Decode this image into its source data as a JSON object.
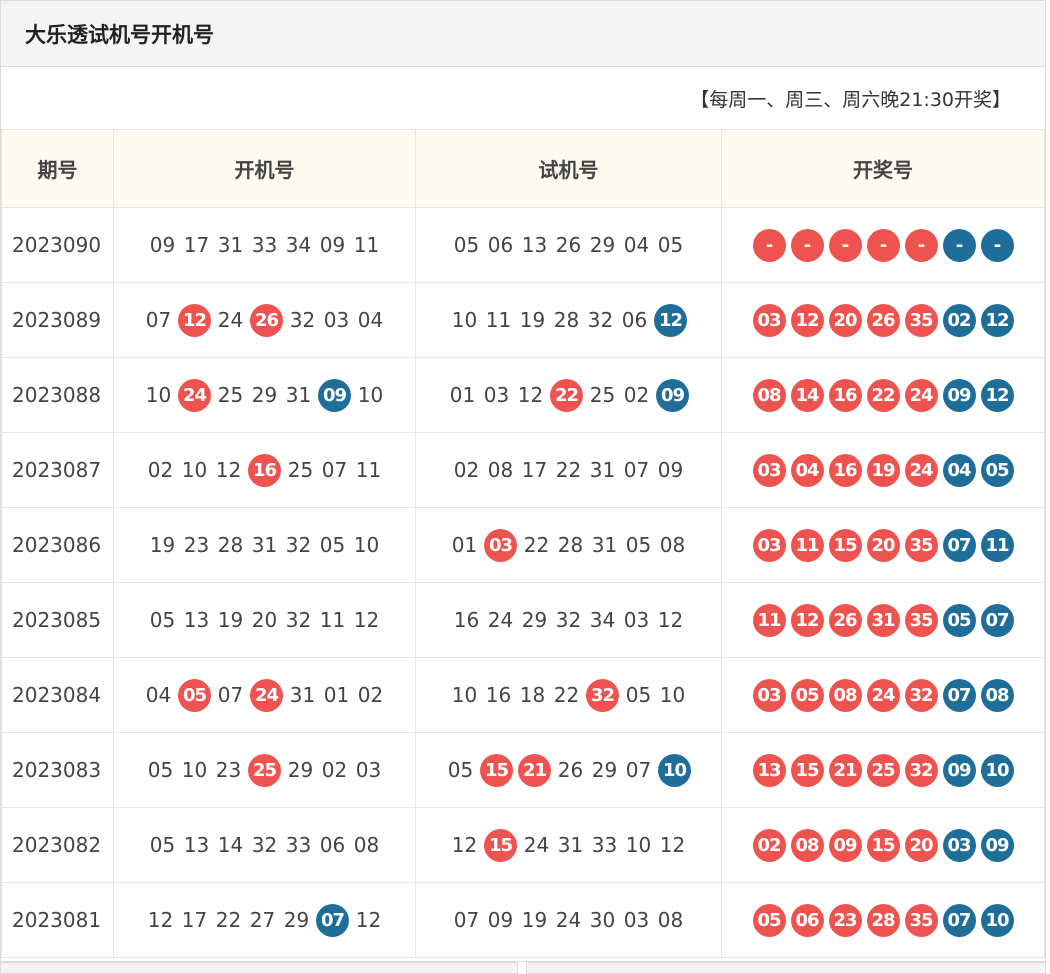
{
  "title": "大乐透试机号开机号",
  "note": "【每周一、周三、周六晚21:30开奖】",
  "headers": {
    "period": "期号",
    "open": "开机号",
    "trial": "试机号",
    "draw": "开奖号"
  },
  "colors": {
    "red_ball": "#ef5350",
    "blue_ball": "#1f6e9a",
    "header_bg": "#fdfaf1"
  },
  "rows": [
    {
      "period": "2023090",
      "open": [
        [
          "09",
          ""
        ],
        [
          "17",
          ""
        ],
        [
          "31",
          ""
        ],
        [
          "33",
          ""
        ],
        [
          "34",
          ""
        ],
        [
          "09",
          ""
        ],
        [
          "11",
          ""
        ]
      ],
      "trial": [
        [
          "05",
          ""
        ],
        [
          "06",
          ""
        ],
        [
          "13",
          ""
        ],
        [
          "26",
          ""
        ],
        [
          "29",
          ""
        ],
        [
          "04",
          ""
        ],
        [
          "05",
          ""
        ]
      ],
      "draw": [
        [
          "-",
          "red"
        ],
        [
          "-",
          "red"
        ],
        [
          "-",
          "red"
        ],
        [
          "-",
          "red"
        ],
        [
          "-",
          "red"
        ],
        [
          "-",
          "blue"
        ],
        [
          "-",
          "blue"
        ]
      ]
    },
    {
      "period": "2023089",
      "open": [
        [
          "07",
          ""
        ],
        [
          "12",
          "red"
        ],
        [
          "24",
          ""
        ],
        [
          "26",
          "red"
        ],
        [
          "32",
          ""
        ],
        [
          "03",
          ""
        ],
        [
          "04",
          ""
        ]
      ],
      "trial": [
        [
          "10",
          ""
        ],
        [
          "11",
          ""
        ],
        [
          "19",
          ""
        ],
        [
          "28",
          ""
        ],
        [
          "32",
          ""
        ],
        [
          "06",
          ""
        ],
        [
          "12",
          "blue"
        ]
      ],
      "draw": [
        [
          "03",
          "red"
        ],
        [
          "12",
          "red"
        ],
        [
          "20",
          "red"
        ],
        [
          "26",
          "red"
        ],
        [
          "35",
          "red"
        ],
        [
          "02",
          "blue"
        ],
        [
          "12",
          "blue"
        ]
      ]
    },
    {
      "period": "2023088",
      "open": [
        [
          "10",
          ""
        ],
        [
          "24",
          "red"
        ],
        [
          "25",
          ""
        ],
        [
          "29",
          ""
        ],
        [
          "31",
          ""
        ],
        [
          "09",
          "blue"
        ],
        [
          "10",
          ""
        ]
      ],
      "trial": [
        [
          "01",
          ""
        ],
        [
          "03",
          ""
        ],
        [
          "12",
          ""
        ],
        [
          "22",
          "red"
        ],
        [
          "25",
          ""
        ],
        [
          "02",
          ""
        ],
        [
          "09",
          "blue"
        ]
      ],
      "draw": [
        [
          "08",
          "red"
        ],
        [
          "14",
          "red"
        ],
        [
          "16",
          "red"
        ],
        [
          "22",
          "red"
        ],
        [
          "24",
          "red"
        ],
        [
          "09",
          "blue"
        ],
        [
          "12",
          "blue"
        ]
      ]
    },
    {
      "period": "2023087",
      "open": [
        [
          "02",
          ""
        ],
        [
          "10",
          ""
        ],
        [
          "12",
          ""
        ],
        [
          "16",
          "red"
        ],
        [
          "25",
          ""
        ],
        [
          "07",
          ""
        ],
        [
          "11",
          ""
        ]
      ],
      "trial": [
        [
          "02",
          ""
        ],
        [
          "08",
          ""
        ],
        [
          "17",
          ""
        ],
        [
          "22",
          ""
        ],
        [
          "31",
          ""
        ],
        [
          "07",
          ""
        ],
        [
          "09",
          ""
        ]
      ],
      "draw": [
        [
          "03",
          "red"
        ],
        [
          "04",
          "red"
        ],
        [
          "16",
          "red"
        ],
        [
          "19",
          "red"
        ],
        [
          "24",
          "red"
        ],
        [
          "04",
          "blue"
        ],
        [
          "05",
          "blue"
        ]
      ]
    },
    {
      "period": "2023086",
      "open": [
        [
          "19",
          ""
        ],
        [
          "23",
          ""
        ],
        [
          "28",
          ""
        ],
        [
          "31",
          ""
        ],
        [
          "32",
          ""
        ],
        [
          "05",
          ""
        ],
        [
          "10",
          ""
        ]
      ],
      "trial": [
        [
          "01",
          ""
        ],
        [
          "03",
          "red"
        ],
        [
          "22",
          ""
        ],
        [
          "28",
          ""
        ],
        [
          "31",
          ""
        ],
        [
          "05",
          ""
        ],
        [
          "08",
          ""
        ]
      ],
      "draw": [
        [
          "03",
          "red"
        ],
        [
          "11",
          "red"
        ],
        [
          "15",
          "red"
        ],
        [
          "20",
          "red"
        ],
        [
          "35",
          "red"
        ],
        [
          "07",
          "blue"
        ],
        [
          "11",
          "blue"
        ]
      ]
    },
    {
      "period": "2023085",
      "open": [
        [
          "05",
          ""
        ],
        [
          "13",
          ""
        ],
        [
          "19",
          ""
        ],
        [
          "20",
          ""
        ],
        [
          "32",
          ""
        ],
        [
          "11",
          ""
        ],
        [
          "12",
          ""
        ]
      ],
      "trial": [
        [
          "16",
          ""
        ],
        [
          "24",
          ""
        ],
        [
          "29",
          ""
        ],
        [
          "32",
          ""
        ],
        [
          "34",
          ""
        ],
        [
          "03",
          ""
        ],
        [
          "12",
          ""
        ]
      ],
      "draw": [
        [
          "11",
          "red"
        ],
        [
          "12",
          "red"
        ],
        [
          "26",
          "red"
        ],
        [
          "31",
          "red"
        ],
        [
          "35",
          "red"
        ],
        [
          "05",
          "blue"
        ],
        [
          "07",
          "blue"
        ]
      ]
    },
    {
      "period": "2023084",
      "open": [
        [
          "04",
          ""
        ],
        [
          "05",
          "red"
        ],
        [
          "07",
          ""
        ],
        [
          "24",
          "red"
        ],
        [
          "31",
          ""
        ],
        [
          "01",
          ""
        ],
        [
          "02",
          ""
        ]
      ],
      "trial": [
        [
          "10",
          ""
        ],
        [
          "16",
          ""
        ],
        [
          "18",
          ""
        ],
        [
          "22",
          ""
        ],
        [
          "32",
          "red"
        ],
        [
          "05",
          ""
        ],
        [
          "10",
          ""
        ]
      ],
      "draw": [
        [
          "03",
          "red"
        ],
        [
          "05",
          "red"
        ],
        [
          "08",
          "red"
        ],
        [
          "24",
          "red"
        ],
        [
          "32",
          "red"
        ],
        [
          "07",
          "blue"
        ],
        [
          "08",
          "blue"
        ]
      ]
    },
    {
      "period": "2023083",
      "open": [
        [
          "05",
          ""
        ],
        [
          "10",
          ""
        ],
        [
          "23",
          ""
        ],
        [
          "25",
          "red"
        ],
        [
          "29",
          ""
        ],
        [
          "02",
          ""
        ],
        [
          "03",
          ""
        ]
      ],
      "trial": [
        [
          "05",
          ""
        ],
        [
          "15",
          "red"
        ],
        [
          "21",
          "red"
        ],
        [
          "26",
          ""
        ],
        [
          "29",
          ""
        ],
        [
          "07",
          ""
        ],
        [
          "10",
          "blue"
        ]
      ],
      "draw": [
        [
          "13",
          "red"
        ],
        [
          "15",
          "red"
        ],
        [
          "21",
          "red"
        ],
        [
          "25",
          "red"
        ],
        [
          "32",
          "red"
        ],
        [
          "09",
          "blue"
        ],
        [
          "10",
          "blue"
        ]
      ]
    },
    {
      "period": "2023082",
      "open": [
        [
          "05",
          ""
        ],
        [
          "13",
          ""
        ],
        [
          "14",
          ""
        ],
        [
          "32",
          ""
        ],
        [
          "33",
          ""
        ],
        [
          "06",
          ""
        ],
        [
          "08",
          ""
        ]
      ],
      "trial": [
        [
          "12",
          ""
        ],
        [
          "15",
          "red"
        ],
        [
          "24",
          ""
        ],
        [
          "31",
          ""
        ],
        [
          "33",
          ""
        ],
        [
          "10",
          ""
        ],
        [
          "12",
          ""
        ]
      ],
      "draw": [
        [
          "02",
          "red"
        ],
        [
          "08",
          "red"
        ],
        [
          "09",
          "red"
        ],
        [
          "15",
          "red"
        ],
        [
          "20",
          "red"
        ],
        [
          "03",
          "blue"
        ],
        [
          "09",
          "blue"
        ]
      ]
    },
    {
      "period": "2023081",
      "open": [
        [
          "12",
          ""
        ],
        [
          "17",
          ""
        ],
        [
          "22",
          ""
        ],
        [
          "27",
          ""
        ],
        [
          "29",
          ""
        ],
        [
          "07",
          "blue"
        ],
        [
          "12",
          ""
        ]
      ],
      "trial": [
        [
          "07",
          ""
        ],
        [
          "09",
          ""
        ],
        [
          "19",
          ""
        ],
        [
          "24",
          ""
        ],
        [
          "30",
          ""
        ],
        [
          "03",
          ""
        ],
        [
          "08",
          ""
        ]
      ],
      "draw": [
        [
          "05",
          "red"
        ],
        [
          "06",
          "red"
        ],
        [
          "23",
          "red"
        ],
        [
          "28",
          "red"
        ],
        [
          "35",
          "red"
        ],
        [
          "07",
          "blue"
        ],
        [
          "10",
          "blue"
        ]
      ]
    }
  ]
}
